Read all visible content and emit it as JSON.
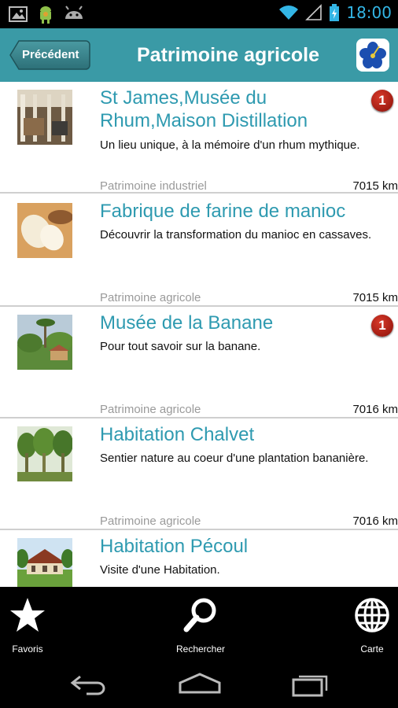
{
  "status_bar": {
    "time": "18:00"
  },
  "action_bar": {
    "back_label": "Précédent",
    "title": "Patrimoine agricole"
  },
  "items": [
    {
      "name": "St James,Musée du Rhum,Maison Distillation",
      "description": "Un lieu unique, à la mémoire d'un rhum mythique.",
      "category": "Patrimoine industriel",
      "distance": "7015 km",
      "badge": "1"
    },
    {
      "name": "Fabrique de farine de manioc",
      "description": "Découvrir la transformation du manioc en cassaves.",
      "category": "Patrimoine agricole",
      "distance": "7015 km",
      "badge": ""
    },
    {
      "name": "Musée de la Banane",
      "description": "Pour tout savoir sur la banane.",
      "category": "Patrimoine agricole",
      "distance": "7016 km",
      "badge": "1"
    },
    {
      "name": "Habitation Chalvet",
      "description": "Sentier nature au coeur d'une plantation bananière.",
      "category": "Patrimoine agricole",
      "distance": "7016 km",
      "badge": ""
    },
    {
      "name": "Habitation Pécoul",
      "description": "Visite d'une Habitation.",
      "category": "",
      "distance": "",
      "badge": ""
    }
  ],
  "tabs": {
    "favorites": "Favoris",
    "search": "Rechercher",
    "map": "Carte"
  },
  "colors": {
    "action_bar": "#3a9aa6",
    "item_title": "#2e9ab0",
    "badge": "#b3170d",
    "clock": "#33b5e5"
  }
}
